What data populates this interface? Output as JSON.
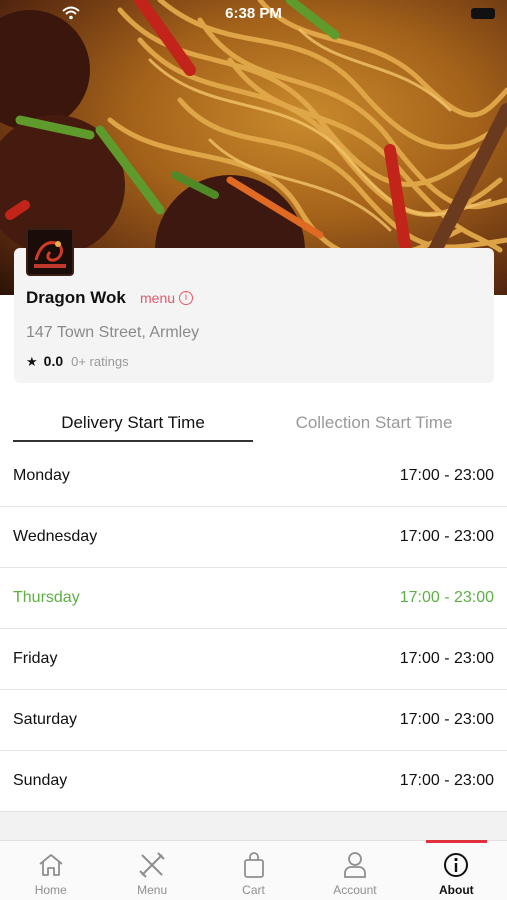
{
  "status": {
    "time": "6:38 PM"
  },
  "restaurant": {
    "name": "Dragon Wok",
    "menu_link": "menu",
    "address": "147 Town Street, Armley",
    "rating": "0.0",
    "ratings_count": "0+ ratings"
  },
  "tabs": [
    {
      "label": "Delivery Start Time",
      "active": true
    },
    {
      "label": "Collection Start Time",
      "active": false
    }
  ],
  "schedule": [
    {
      "day": "Monday",
      "hours": "17:00 - 23:00"
    },
    {
      "day": "Wednesday",
      "hours": "17:00 - 23:00"
    },
    {
      "day": "Thursday",
      "hours": "17:00 - 23:00",
      "highlight": true
    },
    {
      "day": "Friday",
      "hours": "17:00 - 23:00"
    },
    {
      "day": "Saturday",
      "hours": "17:00 - 23:00"
    },
    {
      "day": "Sunday",
      "hours": "17:00 - 23:00"
    }
  ],
  "colors": {
    "accent": "#e0303c",
    "today": "#5cb043",
    "menu_link": "#e05a6a"
  },
  "nav": [
    {
      "label": "Home",
      "icon": "home-icon"
    },
    {
      "label": "Menu",
      "icon": "fork-knife-icon"
    },
    {
      "label": "Cart",
      "icon": "shopping-bag-icon"
    },
    {
      "label": "Account",
      "icon": "account-icon"
    },
    {
      "label": "About",
      "icon": "info-icon",
      "active": true
    }
  ]
}
